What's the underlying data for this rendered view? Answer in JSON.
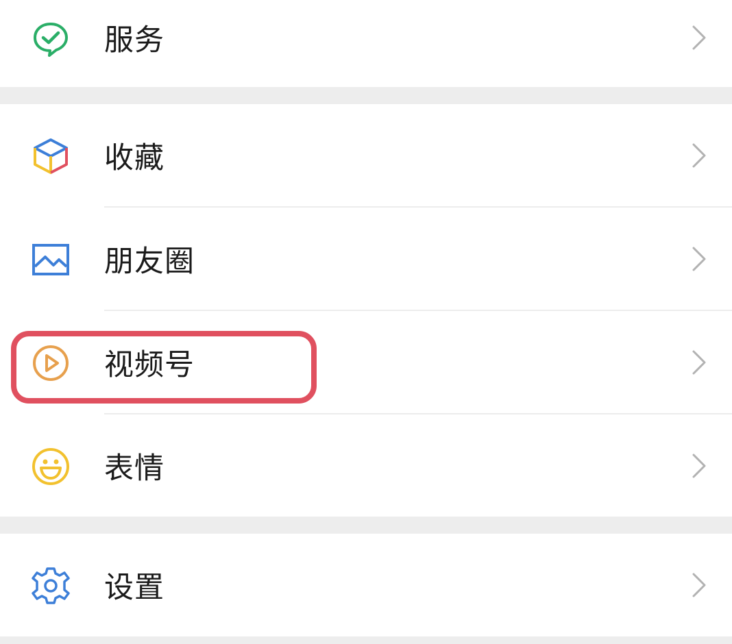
{
  "menu": {
    "groups": [
      {
        "items": [
          {
            "label": "服务",
            "icon": "services-icon",
            "icon_color": "#2aae67"
          }
        ]
      },
      {
        "items": [
          {
            "label": "收藏",
            "icon": "favorites-cube-icon",
            "icon_color": "#3d7fd8"
          },
          {
            "label": "朋友圈",
            "icon": "moments-picture-icon",
            "icon_color": "#3d7fd8"
          },
          {
            "label": "视频号",
            "icon": "channels-play-icon",
            "icon_color": "#e7a04d"
          },
          {
            "label": "表情",
            "icon": "sticker-smile-icon",
            "icon_color": "#f2c12e"
          }
        ]
      },
      {
        "items": [
          {
            "label": "设置",
            "icon": "settings-gear-icon",
            "icon_color": "#3d7fd8"
          }
        ]
      }
    ]
  },
  "annotation": {
    "highlight_color": "#e0505f",
    "highlighted_item": "视频号"
  },
  "colors": {
    "background": "#ededed",
    "row": "#ffffff",
    "chevron": "#b2b2b2",
    "divider": "#ececec"
  }
}
